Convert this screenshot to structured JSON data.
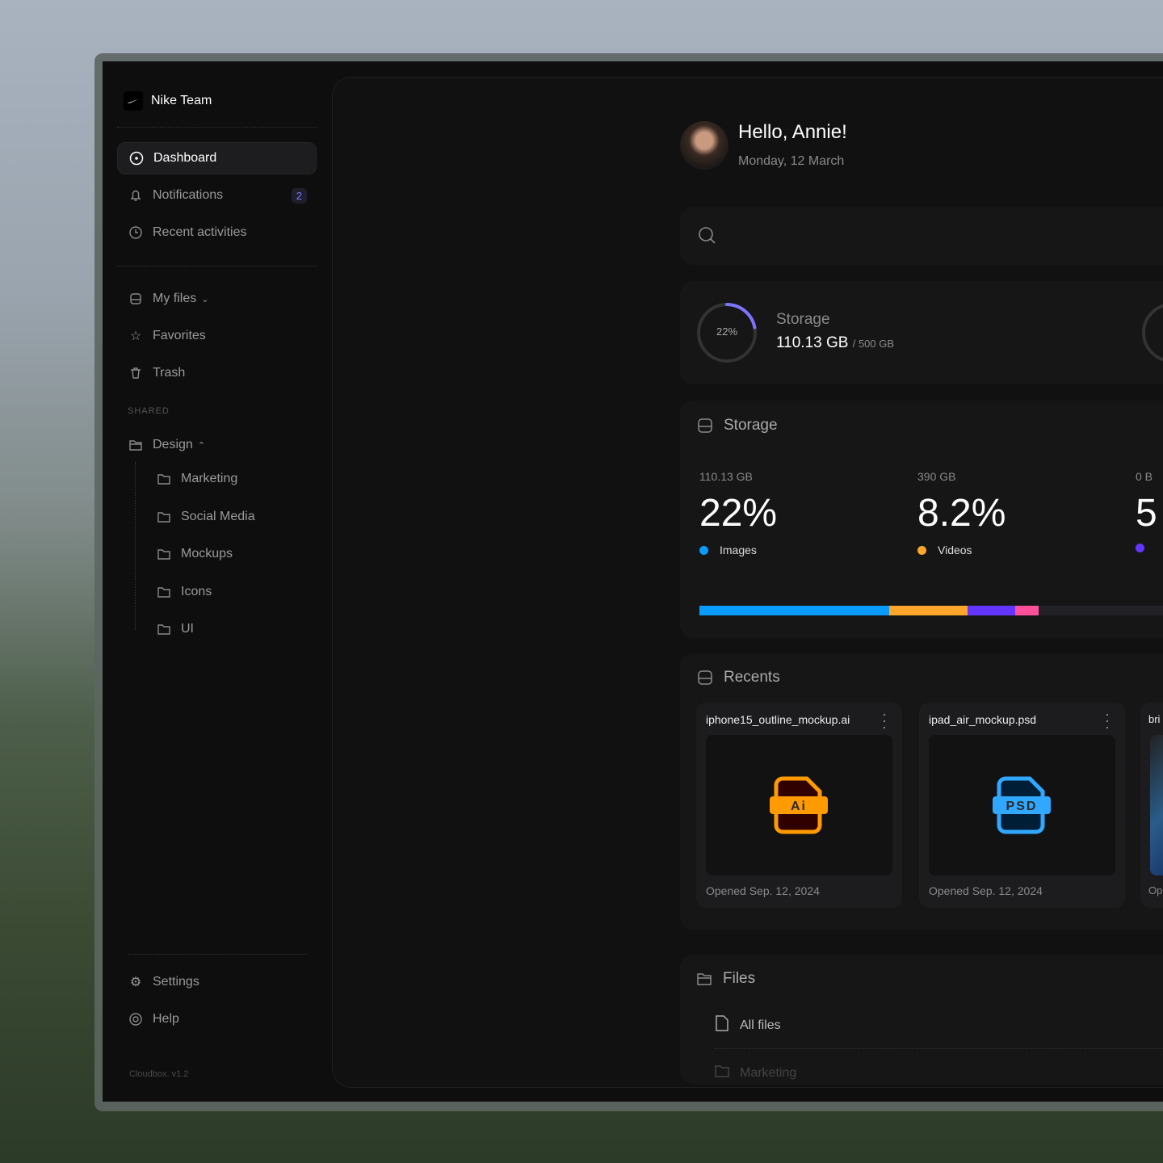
{
  "team": {
    "name": "Nike Team"
  },
  "nav": [
    {
      "label": "Dashboard",
      "icon": "dashboard-icon"
    },
    {
      "label": "Notifications",
      "icon": "bell-icon",
      "badge": "2"
    },
    {
      "label": "Recent activities",
      "icon": "clock-icon"
    }
  ],
  "files_nav": [
    {
      "label": "My files",
      "icon": "drive-icon"
    },
    {
      "label": "Favorites",
      "icon": "star-icon"
    },
    {
      "label": "Trash",
      "icon": "trash-icon"
    }
  ],
  "shared": {
    "heading": "SHARED",
    "folder": "Design",
    "children": [
      "Marketing",
      "Social Media",
      "Mockups",
      "Icons",
      "UI"
    ]
  },
  "bottom": [
    {
      "label": "Settings",
      "icon": "gear-icon"
    },
    {
      "label": "Help",
      "icon": "help-icon"
    }
  ],
  "version": "Cloudbox. v1.2",
  "greeting": {
    "title": "Hello, Annie!",
    "date": "Monday, 12 March"
  },
  "storage_summary": {
    "percent_label": "22%",
    "percent": 22,
    "title": "Storage",
    "used": "110.13 GB",
    "total": "/ 500 GB",
    "ring_color": "#7b74ff"
  },
  "storage": {
    "title": "Storage",
    "cols": [
      {
        "size": "110.13 GB",
        "pct": "22%",
        "label": "Images",
        "color": "#0a9bff"
      },
      {
        "size": "390 GB",
        "pct": "8.2%",
        "label": "Videos",
        "color": "#ffa62b"
      },
      {
        "size": "0 B",
        "pct": "5",
        "label": "",
        "color": "#6236ff"
      }
    ],
    "bar": [
      {
        "color": "#0a9bff",
        "pct": 22
      },
      {
        "color": "#ffa62b",
        "pct": 9
      },
      {
        "color": "#6236ff",
        "pct": 5.5
      },
      {
        "color": "#ff4f9a",
        "pct": 2.8
      }
    ]
  },
  "recents": {
    "title": "Recents",
    "items": [
      {
        "name": "iphone15_outline_mockup.ai",
        "type": "Ai",
        "opened": "Opened Sep. 12, 2024",
        "color": "#ff9a00",
        "fill": "#300000"
      },
      {
        "name": "ipad_air_mockup.psd",
        "type": "PSD",
        "opened": "Opened Sep. 12, 2024",
        "color": "#31a8ff",
        "fill": "#001e36"
      },
      {
        "name": "bri",
        "opened": "Op"
      }
    ]
  },
  "files": {
    "title": "Files",
    "items": [
      "All files",
      "Marketing"
    ]
  }
}
